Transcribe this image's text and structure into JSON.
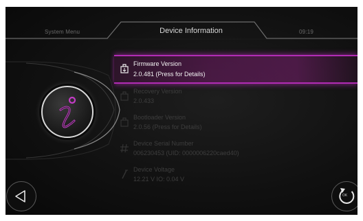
{
  "header": {
    "left_tab": "System Menu",
    "title": "Device Information",
    "clock": "09:19"
  },
  "info_icon": "info-icon",
  "accent_color": "#b22cb5",
  "items": [
    {
      "icon": "firmware-icon",
      "title": "Firmware Version",
      "value": "2.0.481 (Press for Details)",
      "selected": true
    },
    {
      "icon": "recovery-icon",
      "title": "Recovery Version",
      "value": "2.0.433",
      "selected": false
    },
    {
      "icon": "bootloader-icon",
      "title": "Bootloader Version",
      "value": "2.0.56 (Press for Details)",
      "selected": false
    },
    {
      "icon": "hash-icon",
      "title": "Device Serial Number",
      "value": "006230453 (UID: 0000006220caed40)",
      "selected": false
    },
    {
      "icon": "voltage-icon",
      "title": "Device Voltage",
      "value": "12.21 V  IO: 0.04 V",
      "selected": false
    }
  ],
  "buttons": {
    "back_icon": "back-triangle-icon",
    "ok_label": "OK",
    "ok_icon": "refresh-icon"
  }
}
